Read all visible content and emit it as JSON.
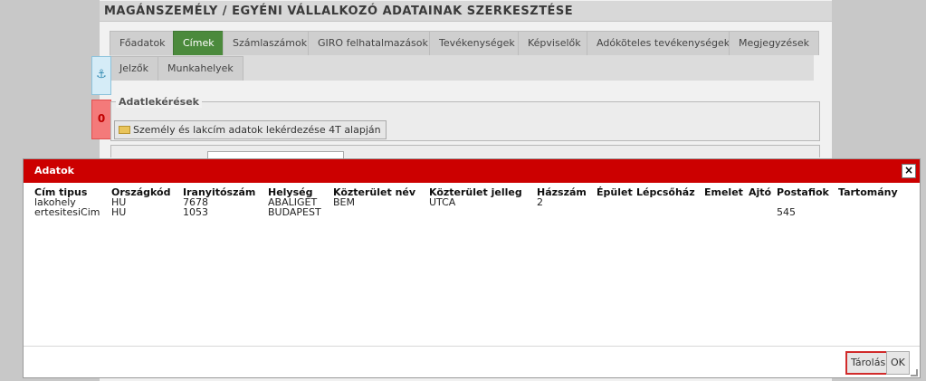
{
  "window": {
    "title": "MAGÁNSZEMÉLY / EGYÉNI VÁLLALKOZÓ ADATAINAK SZERKESZTÉSE"
  },
  "tabs": [
    {
      "label": "Főadatok",
      "active": false
    },
    {
      "label": "Címek",
      "active": true
    },
    {
      "label": "Számlaszámok",
      "active": false
    },
    {
      "label": "GIRO felhatalmazások",
      "active": false
    },
    {
      "label": "Tevékenységek",
      "active": false
    },
    {
      "label": "Képviselők",
      "active": false
    },
    {
      "label": "Adóköteles tevékenységek",
      "active": false
    },
    {
      "label": "Megjegyzések",
      "active": false
    },
    {
      "label": "Jelzők",
      "active": false
    },
    {
      "label": "Munkahelyek",
      "active": false
    }
  ],
  "side": {
    "anchor_glyph": "⚓",
    "error_count": "0"
  },
  "lookup": {
    "legend": "Adatlekérések",
    "button_label": "Személy és lakcím adatok lekérdezése 4T alapján"
  },
  "dialog": {
    "title": "Adatok",
    "close_glyph": "×",
    "columns": [
      "Cím tipus",
      "Országkód",
      "Iranyitószám",
      "Helység",
      "Közterület név",
      "Közterület jelleg",
      "Házszám",
      "Épület",
      "Lépcsőház",
      "Emelet",
      "Ajtó",
      "Postafiok",
      "Tartomány"
    ],
    "rows": [
      [
        "lakohely",
        "HU",
        "7678",
        "ABALIGET",
        "BEM",
        "UTCA",
        "2",
        "",
        "",
        "",
        "",
        "",
        ""
      ],
      [
        "ertesitesiCim",
        "HU",
        "1053",
        "BUDAPEST",
        "",
        "",
        "",
        "",
        "",
        "",
        "",
        "545",
        ""
      ]
    ],
    "save_label": "Tárolás",
    "ok_label": "OK"
  },
  "colors": {
    "header_red": "#cc0000",
    "active_tab_green": "#4b8a3c",
    "highlight_border": "#d12b2b"
  }
}
